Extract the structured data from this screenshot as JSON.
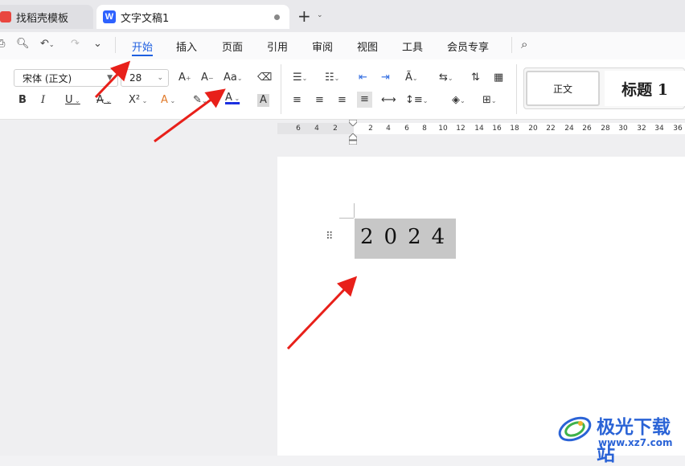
{
  "tabs": [
    {
      "label": "找稻壳模板"
    },
    {
      "label": "文字文稿1",
      "logo_letter": "W"
    }
  ],
  "new_tab_symbol": "+",
  "menu": [
    "开始",
    "插入",
    "页面",
    "引用",
    "审阅",
    "视图",
    "工具",
    "会员专享"
  ],
  "ribbon": {
    "font_name": "宋体 (正文)",
    "font_size": "28",
    "grow_font": "A",
    "shrink_font": "A",
    "change_case": "Aa",
    "bold": "B",
    "italic": "I",
    "underline": "U",
    "strikethrough": "A",
    "superscript": "X²",
    "text_effect": "A",
    "font_color": "A",
    "char_shading": "A",
    "styles": {
      "normal": "正文",
      "heading1": "标题  1"
    }
  },
  "ruler_numbers": [
    "6",
    "4",
    "2",
    "2",
    "4",
    "6",
    "8",
    "10",
    "12",
    "14",
    "16",
    "18",
    "20",
    "22",
    "24",
    "26",
    "28",
    "30",
    "32",
    "34",
    "36"
  ],
  "document": {
    "text": "2024"
  },
  "watermark": {
    "title": "极光下载站",
    "url": "www.xz7.com"
  },
  "colors": {
    "accent": "#1f5fe0",
    "arrow": "#e8201a",
    "font_color_bar": "#1b2fe0"
  }
}
